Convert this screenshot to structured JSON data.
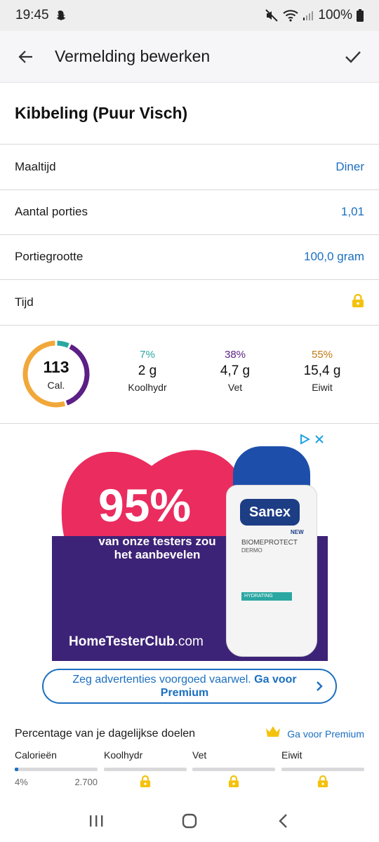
{
  "status": {
    "time": "19:45",
    "battery": "100%"
  },
  "app_bar": {
    "title": "Vermelding bewerken"
  },
  "food": {
    "name": "Kibbeling (Puur Visch)"
  },
  "rows": [
    {
      "label": "Maaltijd",
      "value": "Diner"
    },
    {
      "label": "Aantal porties",
      "value": "1,01"
    },
    {
      "label": "Portiegrootte",
      "value": "100,0 gram"
    },
    {
      "label": "Tijd",
      "value": ""
    }
  ],
  "summary": {
    "calories": "113",
    "calories_unit": "Cal.",
    "macros": [
      {
        "pct": "7%",
        "amount": "2 g",
        "name": "Koolhydr",
        "color": "#2aa7a2",
        "fraction": 0.07
      },
      {
        "pct": "38%",
        "amount": "4,7 g",
        "name": "Vet",
        "color": "#5b1f86",
        "fraction": 0.38
      },
      {
        "pct": "55%",
        "amount": "15,4 g",
        "name": "Eiwit",
        "color": "#f1a83b",
        "fraction": 0.55
      }
    ]
  },
  "ad": {
    "headline": "95%",
    "subline": "van onze testers zou het aanbevelen",
    "brand_bold": "HomeTesterClub",
    "brand_suffix": ".com",
    "product": "Sanex",
    "product_line1": "NEW",
    "product_line2": "BIOMEPROTECT",
    "product_line3": "DERMO",
    "product_line4": "HYDRATING",
    "colors": {
      "heart": "#ea2c5f",
      "band": "#3d2377",
      "cap": "#1d4faa"
    }
  },
  "premium_pill": {
    "text": "Zeg advertenties voorgoed vaarwel.",
    "cta": "Ga voor Premium"
  },
  "goals": {
    "title": "Percentage van je dagelijkse doelen",
    "link": "Ga voor Premium",
    "items": [
      {
        "name": "Calorieën",
        "left": "4%",
        "right": "2.700",
        "progress": 0.04,
        "locked": false
      },
      {
        "name": "Koolhydr",
        "locked": true
      },
      {
        "name": "Vet",
        "locked": true
      },
      {
        "name": "Eiwit",
        "locked": true
      }
    ]
  },
  "colors": {
    "accent": "#1b6fc0",
    "lock": "#f4c20d"
  }
}
